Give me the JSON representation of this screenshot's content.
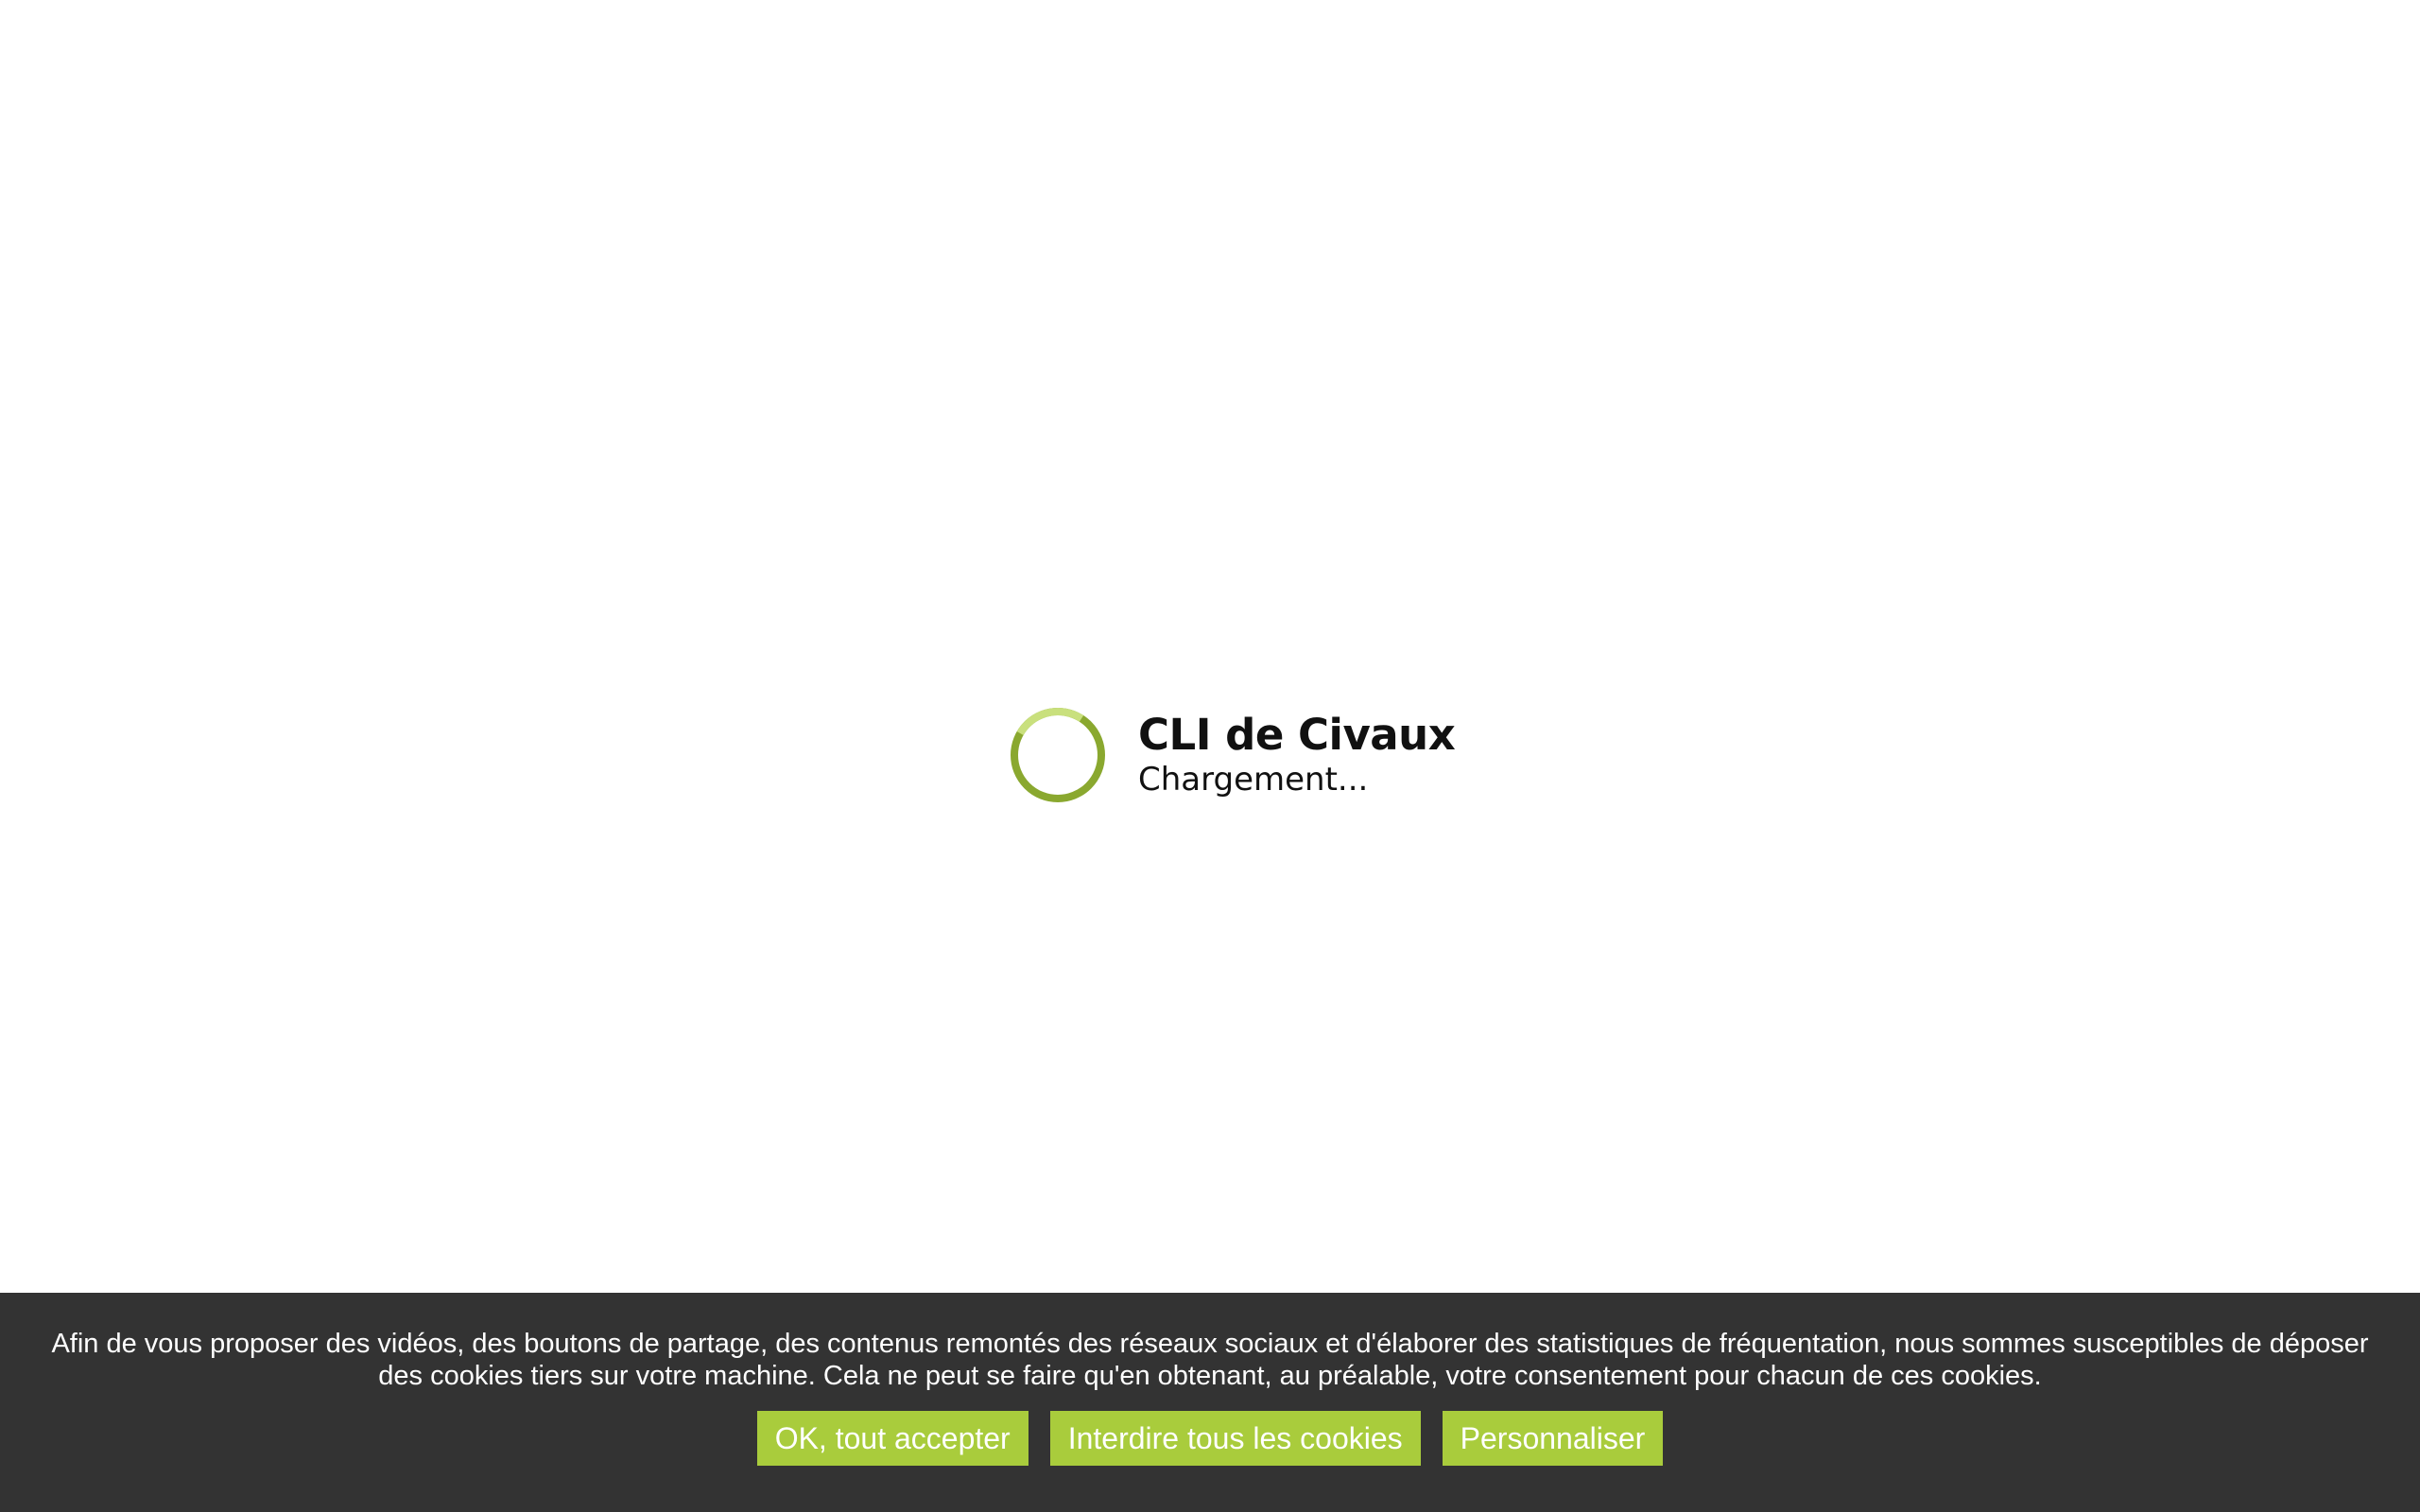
{
  "loader": {
    "title": "CLI de Civaux",
    "subtitle": "Chargement...",
    "spinner_icon": "loading-spinner-icon",
    "spinner_color": "#8aa82f",
    "spinner_track_color": "#c9e07d"
  },
  "cookie_banner": {
    "text": "Afin de vous proposer des vidéos, des boutons de partage, des contenus remontés des réseaux sociaux et d'élaborer des statistiques de fréquentation, nous sommes susceptibles de déposer des cookies tiers sur votre machine. Cela ne peut se faire qu'en obtenant, au préalable, votre consentement pour chacun de ces cookies.",
    "accept_label": "OK, tout accepter",
    "deny_label": "Interdire tous les cookies",
    "customize_label": "Personnaliser",
    "background_color": "#333333",
    "button_color": "#a9cc3c"
  }
}
